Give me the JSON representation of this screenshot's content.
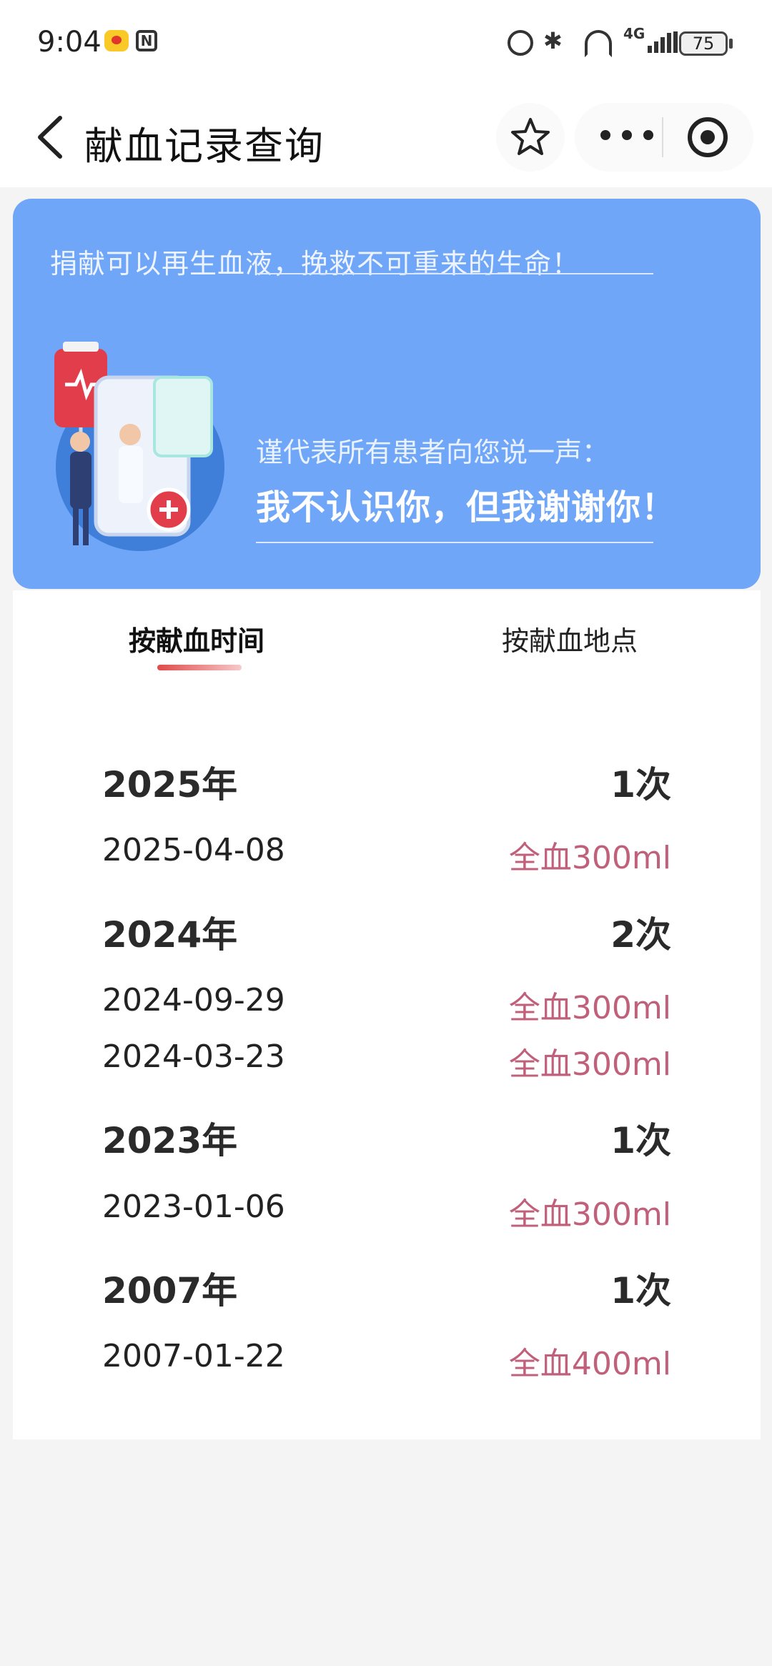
{
  "status_bar": {
    "time": "9:04",
    "battery": "75",
    "network": "4G",
    "icons": [
      "weibo-icon",
      "nfc-icon",
      "alarm-icon",
      "bluetooth-icon",
      "vibrate-icon",
      "hotspot-icon",
      "signal-icon",
      "battery-icon"
    ]
  },
  "header": {
    "title": "献血记录查询",
    "icons": [
      "back-icon",
      "star-icon",
      "more-icon",
      "target-icon"
    ]
  },
  "banner": {
    "slogan": "捐献可以再生血液，挽救不可重来的生命！",
    "thanks_small": "谨代表所有患者向您说一声：",
    "thanks_big": "我不认识你，但我谢谢你！"
  },
  "tabs": [
    {
      "label": "按献血时间",
      "active": true
    },
    {
      "label": "按献血地点",
      "active": false
    }
  ],
  "records": {
    "y2025": {
      "year": "2025年",
      "count": "1次",
      "items": [
        {
          "date": "2025-04-08",
          "amount": "全血300ml"
        }
      ]
    },
    "y2024": {
      "year": "2024年",
      "count": "2次",
      "items": [
        {
          "date": "2024-09-29",
          "amount": "全血300ml"
        },
        {
          "date": "2024-03-23",
          "amount": "全血300ml"
        }
      ]
    },
    "y2023": {
      "year": "2023年",
      "count": "1次",
      "items": [
        {
          "date": "2023-01-06",
          "amount": "全血300ml"
        }
      ]
    },
    "y2007": {
      "year": "2007年",
      "count": "1次",
      "items": [
        {
          "date": "2007-01-22",
          "amount": "全血400ml"
        }
      ]
    }
  },
  "colors": {
    "banner_bg": "#6fa6f7",
    "amount_text": "#c0607a",
    "tab_underline": "#e04a4a"
  }
}
